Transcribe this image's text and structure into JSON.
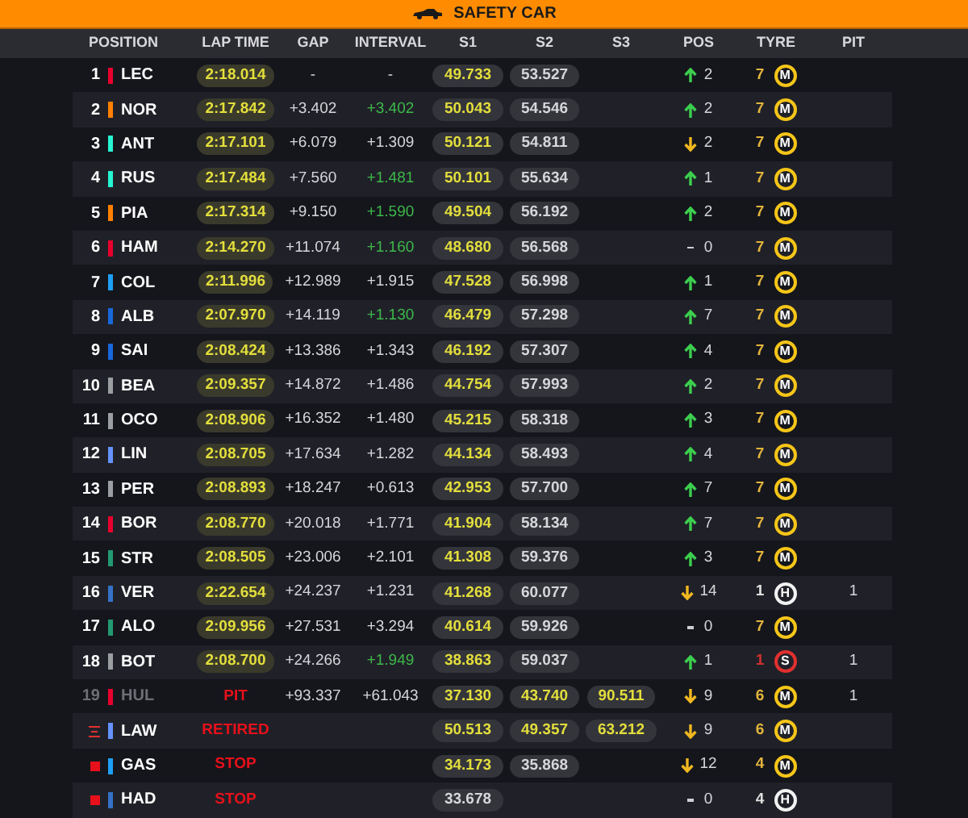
{
  "banner": {
    "title": "SAFETY CAR"
  },
  "columns": [
    "POSITION",
    "LAP TIME",
    "GAP",
    "INTERVAL",
    "S1",
    "S2",
    "S3",
    "POS",
    "TYRE",
    "PIT"
  ],
  "rows": [
    {
      "position": {
        "kind": "number",
        "text": "1"
      },
      "color": "#e8002d",
      "driver": "LEC",
      "dimmed": false,
      "lap": {
        "kind": "time",
        "text": "2:18.014"
      },
      "gap": "-",
      "interval": {
        "text": "-",
        "faster": false
      },
      "s1": {
        "text": "49.733",
        "best": true
      },
      "s2": {
        "text": "53.527",
        "best": false
      },
      "change": {
        "kind": "up",
        "text": "2"
      },
      "tyre": {
        "laps": "7",
        "compound": "M",
        "kind": "medium"
      }
    },
    {
      "position": {
        "kind": "number",
        "text": "2"
      },
      "color": "#ff8000",
      "driver": "NOR",
      "dimmed": false,
      "lap": {
        "kind": "time",
        "text": "2:17.842"
      },
      "gap": "+3.402",
      "interval": {
        "text": "+3.402",
        "faster": true
      },
      "s1": {
        "text": "50.043",
        "best": true
      },
      "s2": {
        "text": "54.546",
        "best": false
      },
      "change": {
        "kind": "up",
        "text": "2"
      },
      "tyre": {
        "laps": "7",
        "compound": "M",
        "kind": "medium"
      }
    },
    {
      "position": {
        "kind": "number",
        "text": "3"
      },
      "color": "#27f4d2",
      "driver": "ANT",
      "dimmed": false,
      "lap": {
        "kind": "time",
        "text": "2:17.101"
      },
      "gap": "+6.079",
      "interval": {
        "text": "+1.309",
        "faster": false
      },
      "s1": {
        "text": "50.121",
        "best": true
      },
      "s2": {
        "text": "54.811",
        "best": false
      },
      "change": {
        "kind": "down",
        "text": "2"
      },
      "tyre": {
        "laps": "7",
        "compound": "M",
        "kind": "medium"
      }
    },
    {
      "position": {
        "kind": "number",
        "text": "4"
      },
      "color": "#27f4d2",
      "driver": "RUS",
      "dimmed": false,
      "lap": {
        "kind": "time",
        "text": "2:17.484"
      },
      "gap": "+7.560",
      "interval": {
        "text": "+1.481",
        "faster": true
      },
      "s1": {
        "text": "50.101",
        "best": true
      },
      "s2": {
        "text": "55.634",
        "best": false
      },
      "change": {
        "kind": "up",
        "text": "1"
      },
      "tyre": {
        "laps": "7",
        "compound": "M",
        "kind": "medium"
      }
    },
    {
      "position": {
        "kind": "number",
        "text": "5"
      },
      "color": "#ff8000",
      "driver": "PIA",
      "dimmed": false,
      "lap": {
        "kind": "time",
        "text": "2:17.314"
      },
      "gap": "+9.150",
      "interval": {
        "text": "+1.590",
        "faster": true
      },
      "s1": {
        "text": "49.504",
        "best": true
      },
      "s2": {
        "text": "56.192",
        "best": false
      },
      "change": {
        "kind": "up",
        "text": "2"
      },
      "tyre": {
        "laps": "7",
        "compound": "M",
        "kind": "medium"
      }
    },
    {
      "position": {
        "kind": "number",
        "text": "6"
      },
      "color": "#e8002d",
      "driver": "HAM",
      "dimmed": false,
      "lap": {
        "kind": "time",
        "text": "2:14.270"
      },
      "gap": "+11.074",
      "interval": {
        "text": "+1.160",
        "faster": true
      },
      "s1": {
        "text": "48.680",
        "best": true
      },
      "s2": {
        "text": "56.568",
        "best": false
      },
      "change": {
        "kind": "none",
        "text": "0"
      },
      "tyre": {
        "laps": "7",
        "compound": "M",
        "kind": "medium"
      }
    },
    {
      "position": {
        "kind": "number",
        "text": "7"
      },
      "color": "#1e9ff5",
      "driver": "COL",
      "dimmed": false,
      "lap": {
        "kind": "time",
        "text": "2:11.996"
      },
      "gap": "+12.989",
      "interval": {
        "text": "+1.915",
        "faster": false
      },
      "s1": {
        "text": "47.528",
        "best": true
      },
      "s2": {
        "text": "56.998",
        "best": false
      },
      "change": {
        "kind": "up",
        "text": "1"
      },
      "tyre": {
        "laps": "7",
        "compound": "M",
        "kind": "medium"
      }
    },
    {
      "position": {
        "kind": "number",
        "text": "8"
      },
      "color": "#1868db",
      "driver": "ALB",
      "dimmed": false,
      "lap": {
        "kind": "time",
        "text": "2:07.970"
      },
      "gap": "+14.119",
      "interval": {
        "text": "+1.130",
        "faster": true
      },
      "s1": {
        "text": "46.479",
        "best": true
      },
      "s2": {
        "text": "57.298",
        "best": false
      },
      "change": {
        "kind": "up",
        "text": "7"
      },
      "tyre": {
        "laps": "7",
        "compound": "M",
        "kind": "medium"
      }
    },
    {
      "position": {
        "kind": "number",
        "text": "9"
      },
      "color": "#1868db",
      "driver": "SAI",
      "dimmed": false,
      "lap": {
        "kind": "time",
        "text": "2:08.424"
      },
      "gap": "+13.386",
      "interval": {
        "text": "+1.343",
        "faster": false
      },
      "s1": {
        "text": "46.192",
        "best": true
      },
      "s2": {
        "text": "57.307",
        "best": false
      },
      "change": {
        "kind": "up",
        "text": "4"
      },
      "tyre": {
        "laps": "7",
        "compound": "M",
        "kind": "medium"
      }
    },
    {
      "position": {
        "kind": "number",
        "text": "10"
      },
      "color": "#9c9fa2",
      "driver": "BEA",
      "dimmed": false,
      "lap": {
        "kind": "time",
        "text": "2:09.357"
      },
      "gap": "+14.872",
      "interval": {
        "text": "+1.486",
        "faster": false
      },
      "s1": {
        "text": "44.754",
        "best": true
      },
      "s2": {
        "text": "57.993",
        "best": false
      },
      "change": {
        "kind": "up",
        "text": "2"
      },
      "tyre": {
        "laps": "7",
        "compound": "M",
        "kind": "medium"
      }
    },
    {
      "position": {
        "kind": "number",
        "text": "11"
      },
      "color": "#9c9fa2",
      "driver": "OCO",
      "dimmed": false,
      "lap": {
        "kind": "time",
        "text": "2:08.906"
      },
      "gap": "+16.352",
      "interval": {
        "text": "+1.480",
        "faster": false
      },
      "s1": {
        "text": "45.215",
        "best": true
      },
      "s2": {
        "text": "58.318",
        "best": false
      },
      "change": {
        "kind": "up",
        "text": "3"
      },
      "tyre": {
        "laps": "7",
        "compound": "M",
        "kind": "medium"
      }
    },
    {
      "position": {
        "kind": "number",
        "text": "12"
      },
      "color": "#6692ff",
      "driver": "LIN",
      "dimmed": false,
      "lap": {
        "kind": "time",
        "text": "2:08.705"
      },
      "gap": "+17.634",
      "interval": {
        "text": "+1.282",
        "faster": false
      },
      "s1": {
        "text": "44.134",
        "best": true
      },
      "s2": {
        "text": "58.493",
        "best": false
      },
      "change": {
        "kind": "up",
        "text": "4"
      },
      "tyre": {
        "laps": "7",
        "compound": "M",
        "kind": "medium"
      }
    },
    {
      "position": {
        "kind": "number",
        "text": "13"
      },
      "color": "#9c9fa2",
      "driver": "PER",
      "dimmed": false,
      "lap": {
        "kind": "time",
        "text": "2:08.893"
      },
      "gap": "+18.247",
      "interval": {
        "text": "+0.613",
        "faster": false
      },
      "s1": {
        "text": "42.953",
        "best": true
      },
      "s2": {
        "text": "57.700",
        "best": false
      },
      "change": {
        "kind": "up",
        "text": "7"
      },
      "tyre": {
        "laps": "7",
        "compound": "M",
        "kind": "medium"
      }
    },
    {
      "position": {
        "kind": "number",
        "text": "14"
      },
      "color": "#e8002d",
      "driver": "BOR",
      "dimmed": false,
      "lap": {
        "kind": "time",
        "text": "2:08.770"
      },
      "gap": "+20.018",
      "interval": {
        "text": "+1.771",
        "faster": false
      },
      "s1": {
        "text": "41.904",
        "best": true
      },
      "s2": {
        "text": "58.134",
        "best": false
      },
      "change": {
        "kind": "up",
        "text": "7"
      },
      "tyre": {
        "laps": "7",
        "compound": "M",
        "kind": "medium"
      }
    },
    {
      "position": {
        "kind": "number",
        "text": "15"
      },
      "color": "#229971",
      "driver": "STR",
      "dimmed": false,
      "lap": {
        "kind": "time",
        "text": "2:08.505"
      },
      "gap": "+23.006",
      "interval": {
        "text": "+2.101",
        "faster": false
      },
      "s1": {
        "text": "41.308",
        "best": true
      },
      "s2": {
        "text": "59.376",
        "best": false
      },
      "change": {
        "kind": "up",
        "text": "3"
      },
      "tyre": {
        "laps": "7",
        "compound": "M",
        "kind": "medium"
      }
    },
    {
      "position": {
        "kind": "number",
        "text": "16"
      },
      "color": "#3671c6",
      "driver": "VER",
      "dimmed": false,
      "lap": {
        "kind": "time",
        "text": "2:22.654"
      },
      "gap": "+24.237",
      "interval": {
        "text": "+1.231",
        "faster": false
      },
      "s1": {
        "text": "41.268",
        "best": true
      },
      "s2": {
        "text": "60.077",
        "best": false
      },
      "change": {
        "kind": "down",
        "text": "14"
      },
      "tyre": {
        "laps": "1",
        "compound": "H",
        "kind": "hard"
      },
      "pit": "1"
    },
    {
      "position": {
        "kind": "number",
        "text": "17"
      },
      "color": "#229971",
      "driver": "ALO",
      "dimmed": false,
      "lap": {
        "kind": "time",
        "text": "2:09.956"
      },
      "gap": "+27.531",
      "interval": {
        "text": "+3.294",
        "faster": false
      },
      "s1": {
        "text": "40.614",
        "best": true
      },
      "s2": {
        "text": "59.926",
        "best": false
      },
      "change": {
        "kind": "none",
        "text": "0"
      },
      "tyre": {
        "laps": "7",
        "compound": "M",
        "kind": "medium"
      }
    },
    {
      "position": {
        "kind": "number",
        "text": "18"
      },
      "color": "#9c9fa2",
      "driver": "BOT",
      "dimmed": false,
      "lap": {
        "kind": "time",
        "text": "2:08.700"
      },
      "gap": "+24.266",
      "interval": {
        "text": "+1.949",
        "faster": true
      },
      "s1": {
        "text": "38.863",
        "best": true
      },
      "s2": {
        "text": "59.037",
        "best": false
      },
      "change": {
        "kind": "up",
        "text": "1"
      },
      "tyre": {
        "laps": "1",
        "compound": "S",
        "kind": "soft"
      },
      "pit": "1"
    },
    {
      "position": {
        "kind": "number",
        "text": "19"
      },
      "color": "#e8002d",
      "driver": "HUL",
      "dimmed": true,
      "lap": {
        "kind": "status",
        "text": "PIT"
      },
      "gap": "+93.337",
      "interval": {
        "text": "+61.043",
        "faster": false
      },
      "s1": {
        "text": "37.130",
        "best": true
      },
      "s2": {
        "text": "43.740",
        "best": true
      },
      "s3": {
        "text": "90.511",
        "best": true
      },
      "change": {
        "kind": "down",
        "text": "9"
      },
      "tyre": {
        "laps": "6",
        "compound": "M",
        "kind": "medium"
      },
      "pit": "1"
    },
    {
      "position": {
        "kind": "retired"
      },
      "color": "#6692ff",
      "driver": "LAW",
      "dimmed": false,
      "lap": {
        "kind": "status",
        "text": "RETIRED"
      },
      "s1": {
        "text": "50.513",
        "best": true
      },
      "s2": {
        "text": "49.357",
        "best": true
      },
      "s3": {
        "text": "63.212",
        "best": true
      },
      "change": {
        "kind": "down",
        "text": "9"
      },
      "tyre": {
        "laps": "6",
        "compound": "M",
        "kind": "medium"
      }
    },
    {
      "position": {
        "kind": "stopped"
      },
      "color": "#1e9ff5",
      "driver": "GAS",
      "dimmed": false,
      "lap": {
        "kind": "status",
        "text": "STOP"
      },
      "s1": {
        "text": "34.173",
        "best": true
      },
      "s2": {
        "text": "35.868",
        "best": false
      },
      "change": {
        "kind": "down",
        "text": "12"
      },
      "tyre": {
        "laps": "4",
        "compound": "M",
        "kind": "medium"
      }
    },
    {
      "position": {
        "kind": "stopped"
      },
      "color": "#3671c6",
      "driver": "HAD",
      "dimmed": false,
      "lap": {
        "kind": "status",
        "text": "STOP"
      },
      "s1": {
        "text": "33.678",
        "best": false
      },
      "change": {
        "kind": "none",
        "text": "0"
      },
      "tyre": {
        "laps": "4",
        "compound": "H",
        "kind": "hard"
      }
    }
  ]
}
